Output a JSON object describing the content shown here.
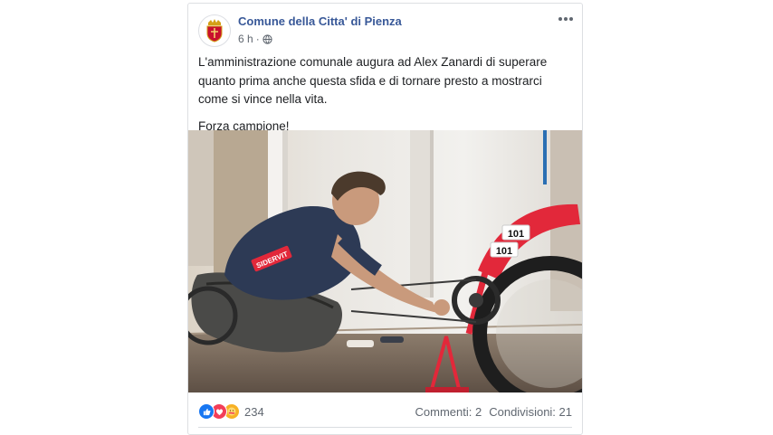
{
  "post": {
    "page_name": "Comune della Citta' di Pienza",
    "time": "6 h",
    "separator": "·",
    "privacy_icon": "globe-icon",
    "avatar_icon": "coat-of-arms-icon",
    "menu_icon": "more-options-icon",
    "paragraphs": [
      "L'amministrazione comunale augura ad Alex Zanardi di superare quanto prima anche questa sfida e di tornare presto a mostrarci come si vince nella vita.",
      "Forza campione!"
    ],
    "photo": {
      "jersey_text": "SIDERVIT",
      "race_number": "101"
    },
    "reactions": {
      "icons": [
        "like-icon",
        "love-icon",
        "care-icon"
      ],
      "count": "234"
    },
    "comments": "Commenti: 2",
    "shares": "Condivisioni: 21"
  },
  "colors": {
    "page_link": "#385898",
    "text": "#1c1e21",
    "secondary": "#606770",
    "like": "#1877f2",
    "love": "#f33e58",
    "care": "#f7b125",
    "bike_red": "#e2283a"
  }
}
